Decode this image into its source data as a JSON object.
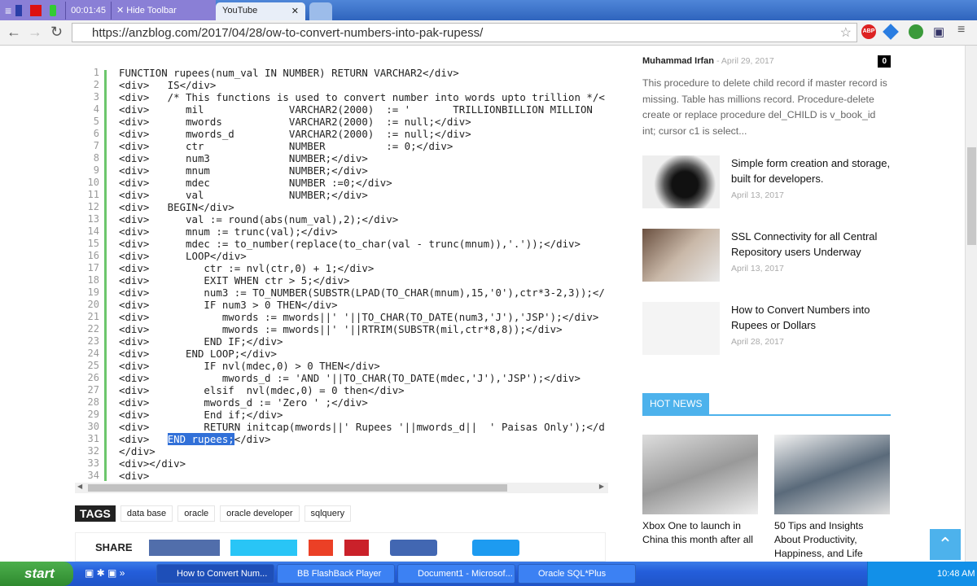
{
  "recorder": {
    "time": "00:01:45",
    "hide_label": "Hide Toolbar"
  },
  "tabs": [
    {
      "label": "YouTube"
    }
  ],
  "address": {
    "url": "https://anzblog.com/2017/04/28/ow-to-convert-numbers-into-pak-rupess/"
  },
  "code": {
    "lines": [
      {
        "n": "1",
        "text": "FUNCTION rupees(num_val IN NUMBER) RETURN VARCHAR2</div>"
      },
      {
        "n": "2",
        "text": "<div>   IS</div>"
      },
      {
        "n": "3",
        "text": "<div>   /* This functions is used to convert number into words upto trillion */<"
      },
      {
        "n": "4",
        "text": "<div>      mil              VARCHAR2(2000)  := '       TRILLIONBILLION MILLION"
      },
      {
        "n": "5",
        "text": "<div>      mwords           VARCHAR2(2000)  := null;</div>"
      },
      {
        "n": "6",
        "text": "<div>      mwords_d         VARCHAR2(2000)  := null;</div>"
      },
      {
        "n": "7",
        "text": "<div>      ctr              NUMBER          := 0;</div>"
      },
      {
        "n": "8",
        "text": "<div>      num3             NUMBER;</div>"
      },
      {
        "n": "9",
        "text": "<div>      mnum             NUMBER;</div>"
      },
      {
        "n": "10",
        "text": "<div>      mdec             NUMBER :=0;</div>"
      },
      {
        "n": "11",
        "text": "<div>      val              NUMBER;</div>"
      },
      {
        "n": "12",
        "text": "<div>   BEGIN</div>"
      },
      {
        "n": "13",
        "text": "<div>      val := round(abs(num_val),2);</div>"
      },
      {
        "n": "14",
        "text": "<div>      mnum := trunc(val);</div>"
      },
      {
        "n": "15",
        "text": "<div>      mdec := to_number(replace(to_char(val - trunc(mnum)),'.'));</div>"
      },
      {
        "n": "16",
        "text": "<div>      LOOP</div>"
      },
      {
        "n": "17",
        "text": "<div>         ctr := nvl(ctr,0) + 1;</div>"
      },
      {
        "n": "18",
        "text": "<div>         EXIT WHEN ctr > 5;</div>"
      },
      {
        "n": "19",
        "text": "<div>         num3 := TO_NUMBER(SUBSTR(LPAD(TO_CHAR(mnum),15,'0'),ctr*3-2,3));</"
      },
      {
        "n": "20",
        "text": "<div>         IF num3 > 0 THEN</div>"
      },
      {
        "n": "21",
        "text": "<div>            mwords := mwords||' '||TO_CHAR(TO_DATE(num3,'J'),'JSP');</div>"
      },
      {
        "n": "22",
        "text": "<div>            mwords := mwords||' '||RTRIM(SUBSTR(mil,ctr*8,8));</div>"
      },
      {
        "n": "23",
        "text": "<div>         END IF;</div>"
      },
      {
        "n": "24",
        "text": "<div>      END LOOP;</div>"
      },
      {
        "n": "25",
        "text": "<div>         IF nvl(mdec,0) > 0 THEN</div>"
      },
      {
        "n": "26",
        "text": "<div>            mwords_d := 'AND '||TO_CHAR(TO_DATE(mdec,'J'),'JSP');</div>"
      },
      {
        "n": "27",
        "text": "<div>         elsif  nvl(mdec,0) = 0 then</div>"
      },
      {
        "n": "28",
        "text": "<div>         mwords_d := 'Zero ' ;</div>"
      },
      {
        "n": "29",
        "text": "<div>         End if;</div>"
      },
      {
        "n": "30",
        "text": "<div>         RETURN initcap(mwords||' Rupees '||mwords_d||  ' Paisas Only');</d"
      },
      {
        "n": "31",
        "pre": "<div>   ",
        "hl": "END rupees;",
        "post": "</div>"
      },
      {
        "n": "32",
        "text": "</div>"
      },
      {
        "n": "33",
        "text": "<div></div>"
      },
      {
        "n": "34",
        "text": "<div>"
      }
    ]
  },
  "tags": {
    "label": "TAGS",
    "items": [
      "data base",
      "oracle",
      "oracle developer",
      "sqlquery"
    ]
  },
  "share": {
    "label": "SHARE"
  },
  "sidebar": {
    "author": "Muhammad Irfan",
    "author_date": "April 29, 2017",
    "comment_count": "0",
    "excerpt": "This procedure to delete child record if master record is missing. Table has millions record. Procedure-delete create or replace procedure del_CHILD is v_book_id int; cursor c1 is select...",
    "items": [
      {
        "title": "Simple form creation and storage, built for developers.",
        "date": "April 13, 2017"
      },
      {
        "title": "SSL Connectivity for all Central Repository users Underway",
        "date": "April 13, 2017"
      },
      {
        "title": "How to Convert Numbers into Rupees or Dollars",
        "date": "April 28, 2017"
      }
    ],
    "hot_news": "HOT NEWS",
    "hot_items": [
      {
        "title": "Xbox One to launch in China this month after all"
      },
      {
        "title": "50 Tips and Insights About Productivity, Happiness, and Life"
      }
    ]
  },
  "taskbar": {
    "start": "start",
    "tasks": [
      "How to Convert Num...",
      "BB FlashBack Player",
      "Document1 - Microsof...",
      "Oracle SQL*Plus"
    ],
    "clock": "10:48 AM"
  }
}
